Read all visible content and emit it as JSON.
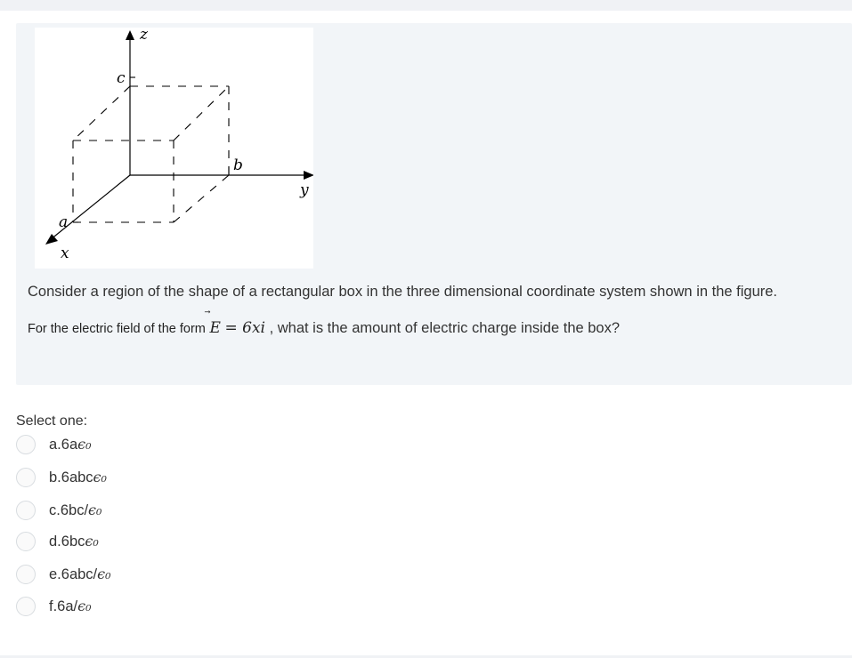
{
  "question": {
    "figure_labels": {
      "z": "z",
      "y": "y",
      "x": "x",
      "a": "a",
      "b": "b",
      "c": "c"
    },
    "statement_line1": "Consider a region of the shape of a rectangular box in the three dimensional coordinate system shown in the figure.",
    "statement_line2_prefix": "For the electric field of the form",
    "field_E": "E",
    "field_eq": " = ",
    "field_value": "6xi",
    "statement_line2_suffix": ", what is the amount of electric charge inside the box?"
  },
  "answer": {
    "select_label": "Select one:",
    "options": [
      {
        "letter": "a.",
        "text": "6a",
        "expr": "ϵ₀",
        "slash": ""
      },
      {
        "letter": "b.",
        "text": "6abc",
        "expr": "ϵ₀",
        "slash": ""
      },
      {
        "letter": "c.",
        "text": "6bc/",
        "expr": "ϵ₀",
        "slash": ""
      },
      {
        "letter": "d.",
        "text": "6bc",
        "expr": "ϵ₀",
        "slash": ""
      },
      {
        "letter": "e.",
        "text": "6abc/",
        "expr": "ϵ₀",
        "slash": ""
      },
      {
        "letter": "f.",
        "text": "6a/",
        "expr": "ϵ₀",
        "slash": ""
      }
    ]
  }
}
